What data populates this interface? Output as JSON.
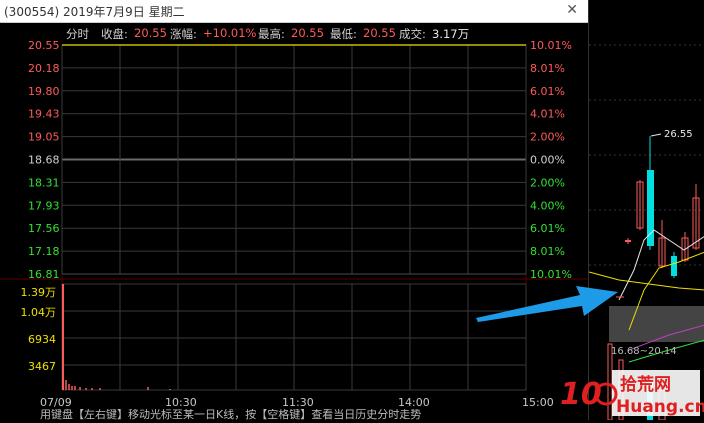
{
  "window": {
    "title": "(300554) 2019年7月9日 星期二",
    "close_icon": "close-icon"
  },
  "header": {
    "tab": "分时",
    "close_label": "收盘:",
    "close_value": "20.55",
    "change_label": "涨幅:",
    "change_value": "+10.01%",
    "high_label": "最高:",
    "high_value": "20.55",
    "low_label": "最低:",
    "low_value": "20.55",
    "volume_label": "成交:",
    "volume_value": "3.17万"
  },
  "price_axis": {
    "prices": [
      "20.55",
      "20.18",
      "19.80",
      "19.43",
      "19.05",
      "18.68",
      "18.31",
      "17.93",
      "17.56",
      "17.18",
      "16.81"
    ],
    "percents": [
      "10.01%",
      "8.01%",
      "6.01%",
      "4.01%",
      "2.00%",
      "0.00%",
      "2.00%",
      "4.00%",
      "6.01%",
      "8.01%",
      "10.01%"
    ]
  },
  "volume_axis": {
    "labels": [
      "1.39万",
      "1.04万",
      "6934",
      "3467"
    ]
  },
  "time_axis": {
    "labels": [
      "07/09",
      "10:30",
      "11:30",
      "14:00",
      "15:00"
    ]
  },
  "kline_panel": {
    "high_label": "26.55",
    "range_label": "16.68~20.14"
  },
  "status_bar": {
    "text": "用键盘【左右键】移动光标至某一日K线，按【空格键】查看当日历史分时走势"
  },
  "watermark": {
    "text_cn": "拾荒网",
    "text_en": "Huang.cn",
    "number": "10"
  },
  "colors": {
    "up": "#ff5a5a",
    "down": "#33e033",
    "price_line": "#f0e000",
    "grid": "#3a3a3a",
    "arrow": "#1e9be8"
  }
}
